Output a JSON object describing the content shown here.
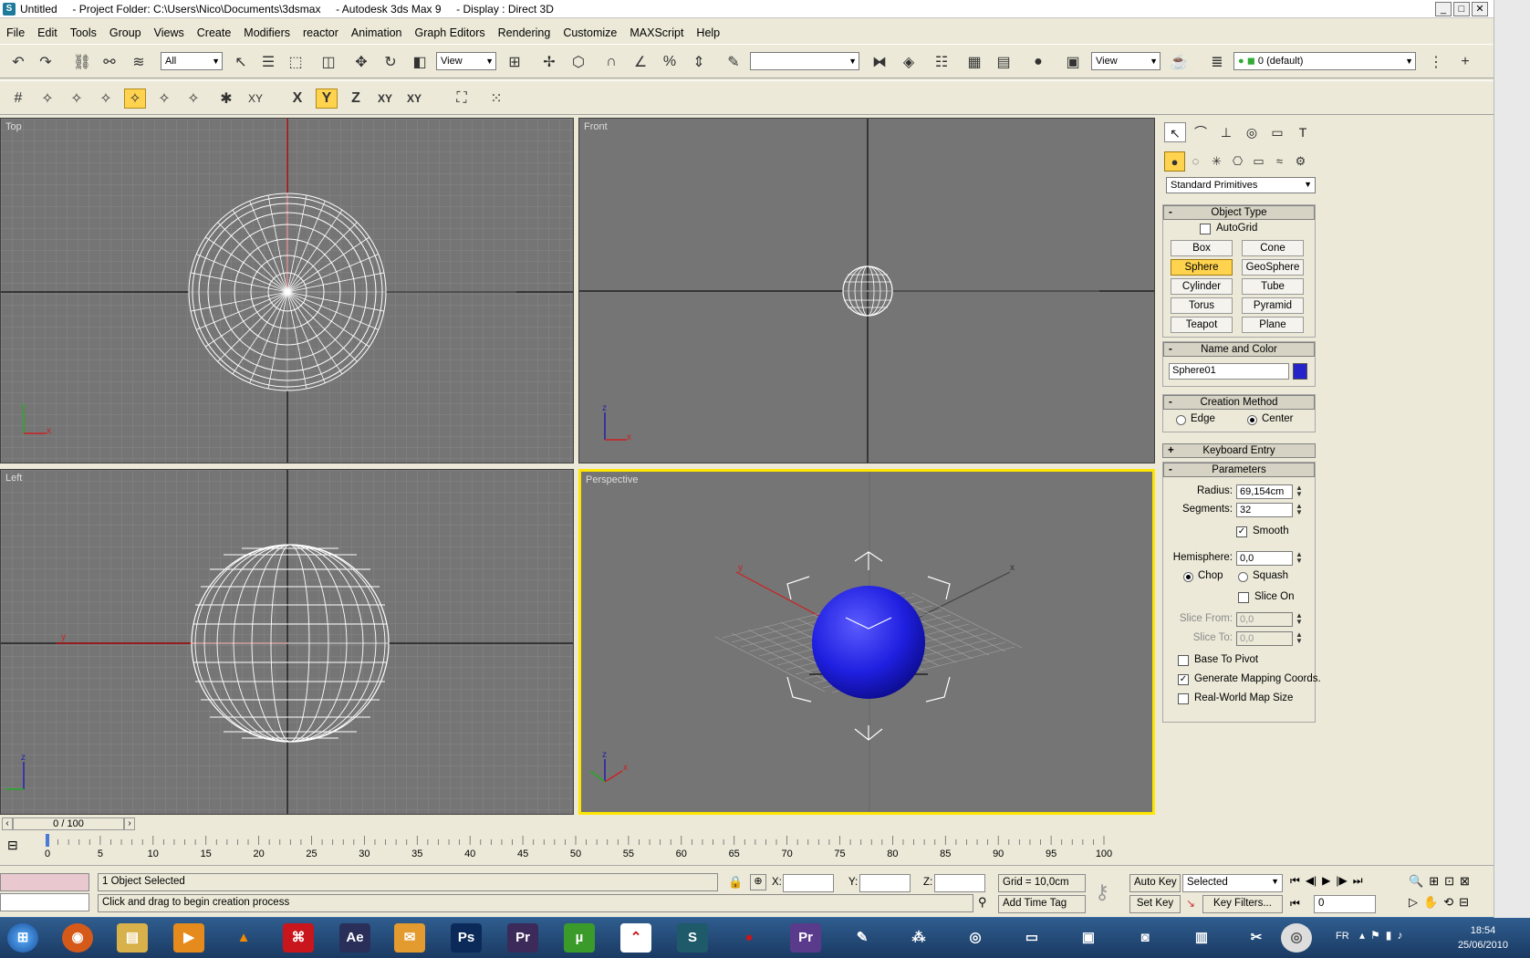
{
  "window": {
    "app_icon": "3dsmax-logo-icon",
    "title": "Untitled     - Project Folder: C:\\Users\\Nico\\Documents\\3dsmax     - Autodesk 3ds Max 9     - Display : Direct 3D",
    "minimize": "_",
    "maximize": "□",
    "close": "✕"
  },
  "menu": [
    "File",
    "Edit",
    "Tools",
    "Group",
    "Views",
    "Create",
    "Modifiers",
    "reactor",
    "Animation",
    "Graph Editors",
    "Rendering",
    "Customize",
    "MAXScript",
    "Help"
  ],
  "toolbar": {
    "selection_filter": "All",
    "ref_coord": "View",
    "named_sel": "",
    "render_view": "View",
    "layer": "0 (default)",
    "axis_x": "X",
    "axis_y": "Y",
    "axis_z": "Z",
    "axis_xy": "XY",
    "axis_xy2": "XY"
  },
  "viewports": {
    "top": {
      "label": "Top"
    },
    "front": {
      "label": "Front"
    },
    "left": {
      "label": "Left"
    },
    "perspective": {
      "label": "Perspective"
    },
    "axis_labels": {
      "x": "x",
      "y": "y",
      "z": "z"
    }
  },
  "command_panel": {
    "category": "Standard Primitives",
    "object_type": {
      "title": "Object Type",
      "autogrid": "AutoGrid",
      "buttons": [
        "Box",
        "Cone",
        "Sphere",
        "GeoSphere",
        "Cylinder",
        "Tube",
        "Torus",
        "Pyramid",
        "Teapot",
        "Plane"
      ],
      "active": "Sphere"
    },
    "name_and_color": {
      "title": "Name and Color",
      "name": "Sphere01",
      "color": "#2424c8"
    },
    "creation_method": {
      "title": "Creation Method",
      "edge": "Edge",
      "center": "Center",
      "selected": "Center"
    },
    "keyboard_entry": {
      "title": "Keyboard Entry"
    },
    "parameters": {
      "title": "Parameters",
      "radius_label": "Radius:",
      "radius": "69,154cm",
      "segments_label": "Segments:",
      "segments": "32",
      "smooth": "Smooth",
      "hemisphere_label": "Hemisphere:",
      "hemisphere": "0,0",
      "chop": "Chop",
      "squash": "Squash",
      "slice_on": "Slice On",
      "slice_from_label": "Slice From:",
      "slice_from": "0,0",
      "slice_to_label": "Slice To:",
      "slice_to": "0,0",
      "base_to_pivot": "Base To Pivot",
      "gen_mapping": "Generate Mapping Coords.",
      "real_world": "Real-World Map Size"
    }
  },
  "timeline": {
    "frame": "0 / 100",
    "ticks": [
      "0",
      "5",
      "10",
      "15",
      "20",
      "25",
      "30",
      "35",
      "40",
      "45",
      "50",
      "55",
      "60",
      "65",
      "70",
      "75",
      "80",
      "85",
      "90",
      "95",
      "100"
    ]
  },
  "status": {
    "selected": "1 Object Selected",
    "prompt": "Click and drag to begin creation process",
    "x_label": "X:",
    "y_label": "Y:",
    "z_label": "Z:",
    "grid": "Grid = 10,0cm",
    "add_time_tag": "Add Time Tag",
    "auto_key": "Auto Key",
    "set_key": "Set Key",
    "selected_mode": "Selected",
    "key_filters": "Key Filters...",
    "frame_field": "0"
  },
  "taskbar": {
    "icons": [
      "start-orb-icon",
      "firefox-icon",
      "explorer-icon",
      "media-player-icon",
      "vlc-icon",
      "acrobat-icon",
      "after-effects-icon",
      "folder-app-icon",
      "photoshop-icon",
      "premiere-icon",
      "utorrent-icon",
      "avira-icon",
      "3dsmax-task-icon",
      "media-icon",
      "premiere2-icon",
      "app-icon",
      "network-icon",
      "film-icon",
      "monitor-icon",
      "video-icon",
      "camera-icon",
      "drive-icon",
      "tools-icon",
      "cd-icon"
    ],
    "labels": {
      "ae": "Ae",
      "ps": "Ps",
      "pr": "Pr",
      "pr2": "Pr",
      "ut": "µ"
    },
    "lang": "FR",
    "time": "18:54",
    "date": "25/06/2010"
  }
}
